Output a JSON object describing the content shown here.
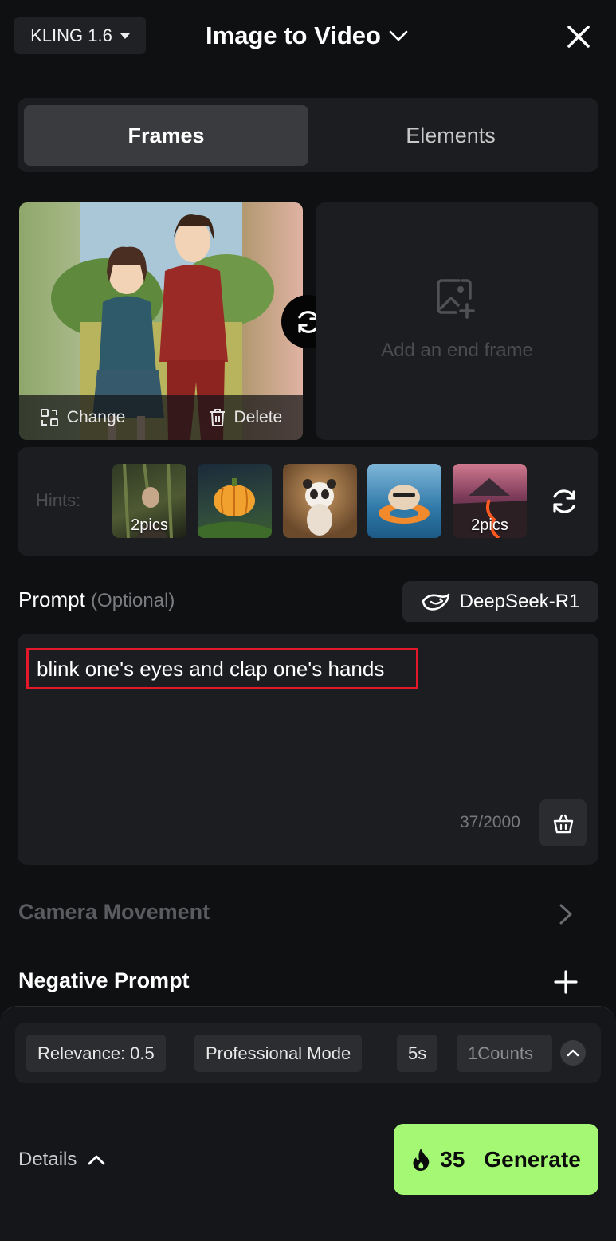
{
  "header": {
    "model_label": "KLING 1.6",
    "title": "Image to Video"
  },
  "tabs": [
    {
      "label": "Frames",
      "active": true
    },
    {
      "label": "Elements",
      "active": false
    }
  ],
  "frames": {
    "start_actions": {
      "change": "Change",
      "delete": "Delete"
    },
    "end_placeholder": "Add an end frame"
  },
  "hints": {
    "label": "Hints:",
    "items": [
      {
        "caption": "2pics",
        "icon": "warrior-thumbnail"
      },
      {
        "caption": "",
        "icon": "pumpkin-thumbnail"
      },
      {
        "caption": "",
        "icon": "panda-thumbnail"
      },
      {
        "caption": "",
        "icon": "hamster-float-thumbnail"
      },
      {
        "caption": "2pics",
        "icon": "volcano-thumbnail"
      }
    ]
  },
  "prompt": {
    "label": "Prompt",
    "optional": "(Optional)",
    "assistant_label": "DeepSeek-R1",
    "text": "blink one's eyes and clap one's hands",
    "counter": "37/2000",
    "highlight_color": "#e3192b"
  },
  "camera_movement": {
    "label": "Camera Movement"
  },
  "negative_prompt": {
    "label": "Negative Prompt"
  },
  "settings": {
    "chips": [
      "Relevance: 0.5",
      "Professional Mode",
      "5s",
      "1Counts"
    ]
  },
  "footer": {
    "details_label": "Details",
    "cost": "35",
    "generate_label": "Generate",
    "accent_color": "#a4f874"
  }
}
